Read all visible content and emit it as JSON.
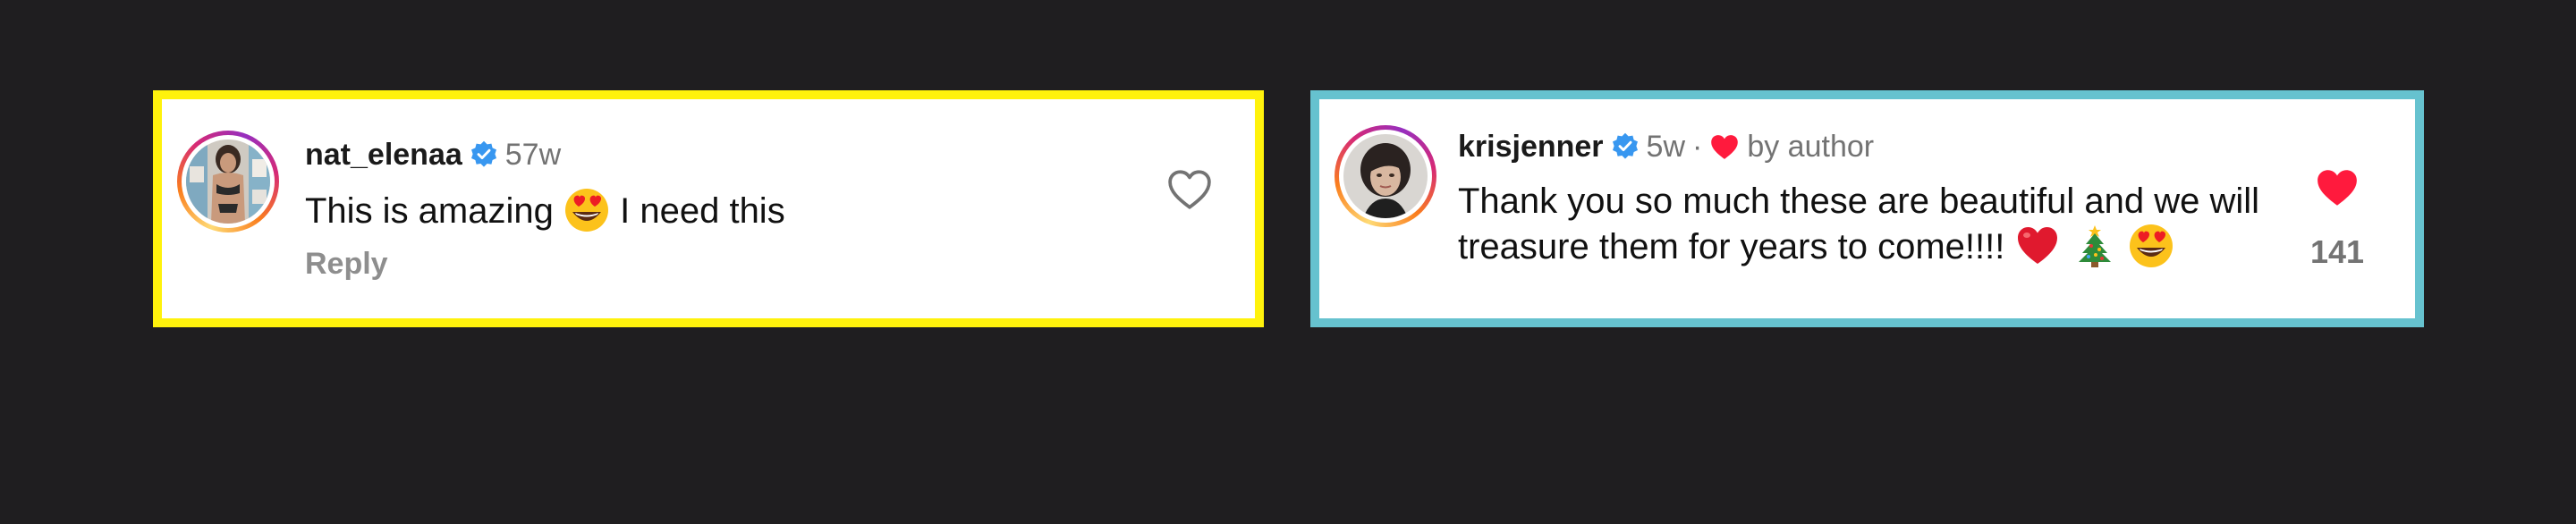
{
  "comments": [
    {
      "username": "nat_elenaa",
      "verified": true,
      "time": "57w",
      "text_before": "This is amazing",
      "emoji": "heart-eyes-emoji",
      "text_after": "I need this",
      "reply_label": "Reply",
      "liked": false,
      "border_color": "#fff20c"
    },
    {
      "username": "krisjenner",
      "verified": true,
      "time": "5w",
      "separator": "·",
      "author_badge": "by author",
      "text": "Thank you so much these are beautiful and we will treasure them for years to come!!!!",
      "emojis": [
        "red-heart-emoji",
        "christmas-tree-emoji",
        "heart-eyes-emoji"
      ],
      "liked": true,
      "like_count": "141",
      "border_color": "#66c2cf"
    }
  ],
  "colors": {
    "background": "#1f1e20",
    "like_red": "#ff1a3d",
    "verified_blue": "#3897f0",
    "secondary_text": "#737373"
  }
}
